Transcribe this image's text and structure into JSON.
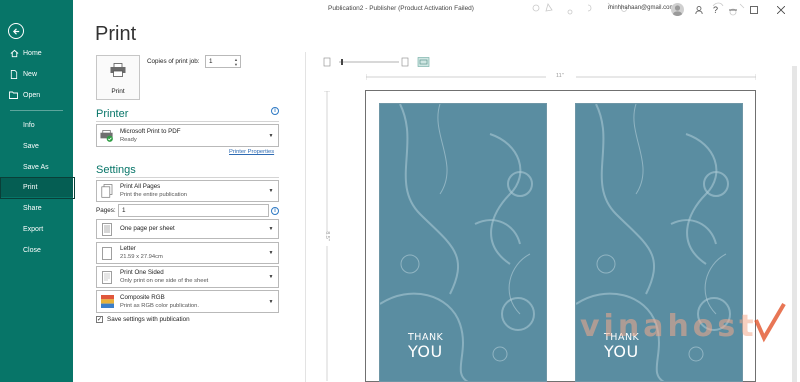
{
  "window": {
    "title": "Publication2 - Publisher (Product Activation Failed)",
    "account": "minhhahaan@gmail.com"
  },
  "nav": {
    "items": [
      {
        "label": "Home",
        "icon": "home-icon"
      },
      {
        "label": "New",
        "icon": "new-document-icon"
      },
      {
        "label": "Open",
        "icon": "folder-open-icon"
      },
      {
        "label": "Info"
      },
      {
        "label": "Save"
      },
      {
        "label": "Save As"
      },
      {
        "label": "Print",
        "active": true
      },
      {
        "label": "Share"
      },
      {
        "label": "Export"
      },
      {
        "label": "Close"
      }
    ]
  },
  "print": {
    "heading": "Print",
    "button_label": "Print",
    "copies_label": "Copies of print job:",
    "copies_value": "1"
  },
  "printer": {
    "heading": "Printer",
    "name": "Microsoft Print to PDF",
    "status": "Ready",
    "properties_link": "Printer Properties"
  },
  "settings": {
    "heading": "Settings",
    "pages_range": {
      "title": "Print All Pages",
      "subtitle": "Print the entire publication"
    },
    "pages_label": "Pages:",
    "pages_value": "1",
    "layout": {
      "title": "One page per sheet"
    },
    "paper": {
      "title": "Letter",
      "subtitle": "21.59 x 27.94cm"
    },
    "sides": {
      "title": "Print One Sided",
      "subtitle": "Only print on one side of the sheet"
    },
    "color": {
      "title": "Composite RGB",
      "subtitle": "Print as RGB color publication."
    },
    "save_with_publication": {
      "label": "Save settings with publication",
      "checked": true
    }
  },
  "preview": {
    "ruler_width_label": "11\"",
    "ruler_height_label": "8.5\"",
    "cards": [
      {
        "line1": "THANK",
        "line2": "YOU"
      },
      {
        "line1": "THANK",
        "line2": "YOU"
      }
    ],
    "card_color": "#5a8da1"
  },
  "colors": {
    "sidebar": "#077568",
    "accent": "#077568"
  },
  "watermark": {
    "text": "vinahost"
  }
}
